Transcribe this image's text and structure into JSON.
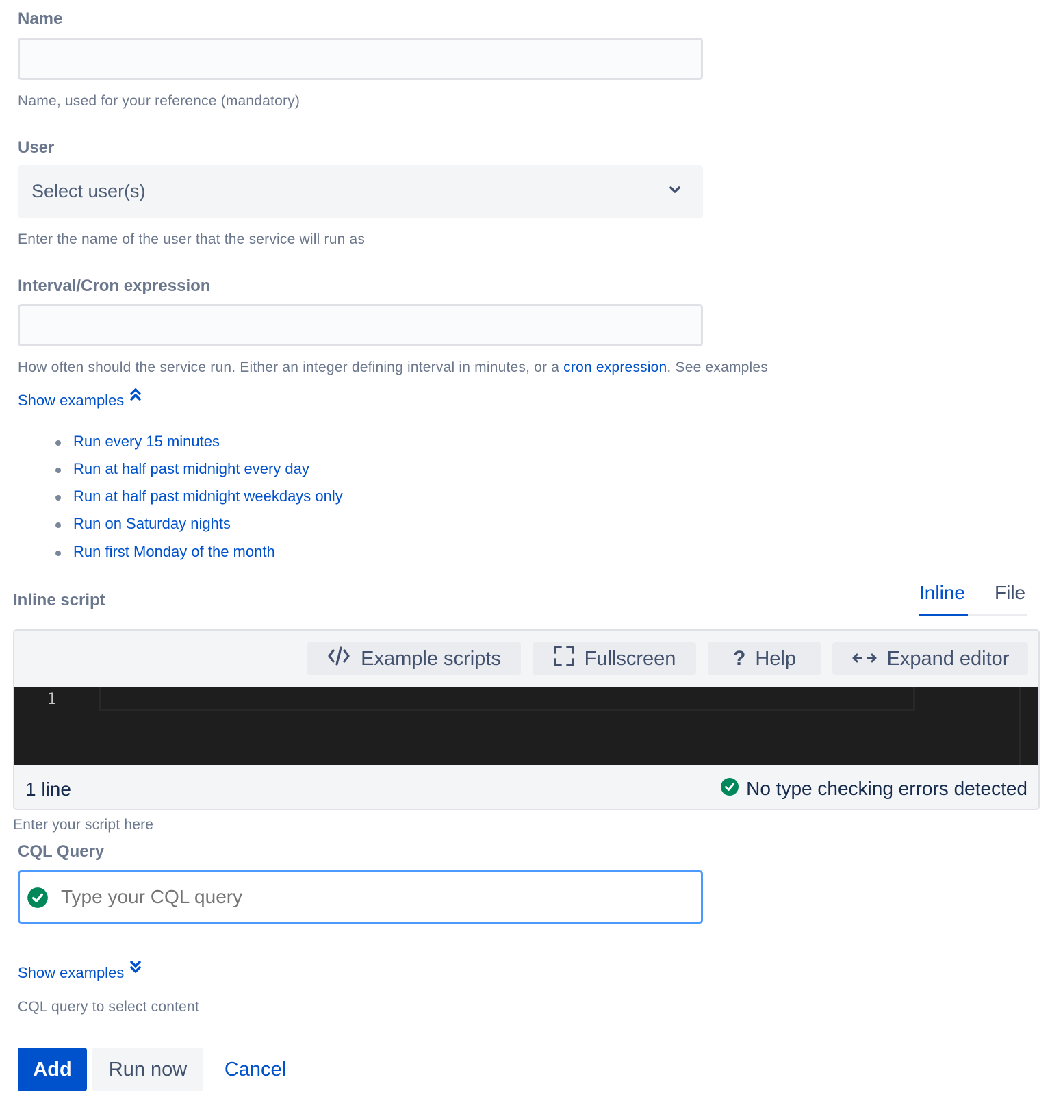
{
  "name_field": {
    "label": "Name",
    "value": "",
    "placeholder": "",
    "help": "Name, used for your reference (mandatory)"
  },
  "user_field": {
    "label": "User",
    "selected": "Select user(s)",
    "help": "Enter the name of the user that the service will run as"
  },
  "interval_field": {
    "label": "Interval/Cron expression",
    "value": "",
    "placeholder": "",
    "help_prefix": "How often should the service run. Either an integer defining interval in minutes, or a ",
    "help_link": "cron expression",
    "help_suffix": ". See examples",
    "show_examples": "Show examples",
    "examples": [
      "Run every 15 minutes",
      "Run at half past midnight every day",
      "Run at half past midnight weekdays only",
      "Run on Saturday nights",
      "Run first Monday of the month"
    ]
  },
  "script": {
    "label": "Inline script",
    "tabs": [
      {
        "label": "Inline",
        "active": true
      },
      {
        "label": "File",
        "active": false
      }
    ],
    "toolbar": {
      "example_scripts": "Example scripts",
      "fullscreen": "Fullscreen",
      "help": "Help",
      "expand_editor": "Expand editor"
    },
    "line_numbers": [
      "1"
    ],
    "line_count": "1 line",
    "status": "No type checking errors detected",
    "help": "Enter your script here"
  },
  "cql_field": {
    "label": "CQL Query",
    "value": "",
    "placeholder": "Type your CQL query",
    "show_examples": "Show examples",
    "help": "CQL query to select content"
  },
  "actions": {
    "add": "Add",
    "run_now": "Run now",
    "cancel": "Cancel"
  },
  "colors": {
    "link": "#0052cc",
    "primary": "#0052cc",
    "success": "#00875a",
    "focus_border": "#4c9aff",
    "editor_bg": "#1e1e1e"
  }
}
